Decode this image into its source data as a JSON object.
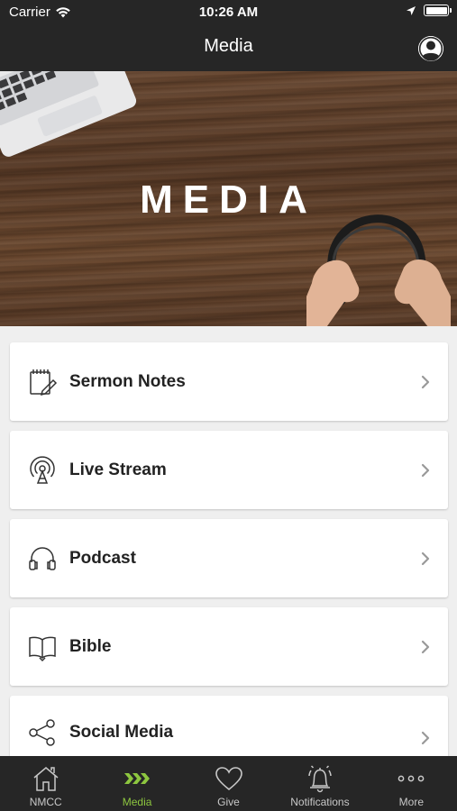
{
  "status_bar": {
    "carrier": "Carrier",
    "time": "10:26 AM",
    "icons": [
      "wifi-icon",
      "location-arrow-icon",
      "battery-icon"
    ]
  },
  "nav": {
    "title": "Media",
    "profile_icon": "user-circle-icon"
  },
  "hero": {
    "title": "MEDIA"
  },
  "menu": [
    {
      "label": "Sermon Notes",
      "icon": "notepad-pencil-icon"
    },
    {
      "label": "Live Stream",
      "icon": "broadcast-tower-icon"
    },
    {
      "label": "Podcast",
      "icon": "headphones-icon"
    },
    {
      "label": "Bible",
      "icon": "open-book-icon"
    },
    {
      "label": "Social Media",
      "icon": "share-nodes-icon"
    }
  ],
  "tabs": [
    {
      "label": "NMCC",
      "icon": "home-icon",
      "active": false
    },
    {
      "label": "Media",
      "icon": "chevrons-right-icon",
      "active": true
    },
    {
      "label": "Give",
      "icon": "heart-icon",
      "active": false
    },
    {
      "label": "Notifications",
      "icon": "bell-ringing-icon",
      "active": false
    },
    {
      "label": "More",
      "icon": "more-dots-icon",
      "active": false
    }
  ],
  "colors": {
    "bar_background": "#262626",
    "accent": "#8dc63f",
    "list_background": "#efefef",
    "card_background": "#ffffff"
  }
}
